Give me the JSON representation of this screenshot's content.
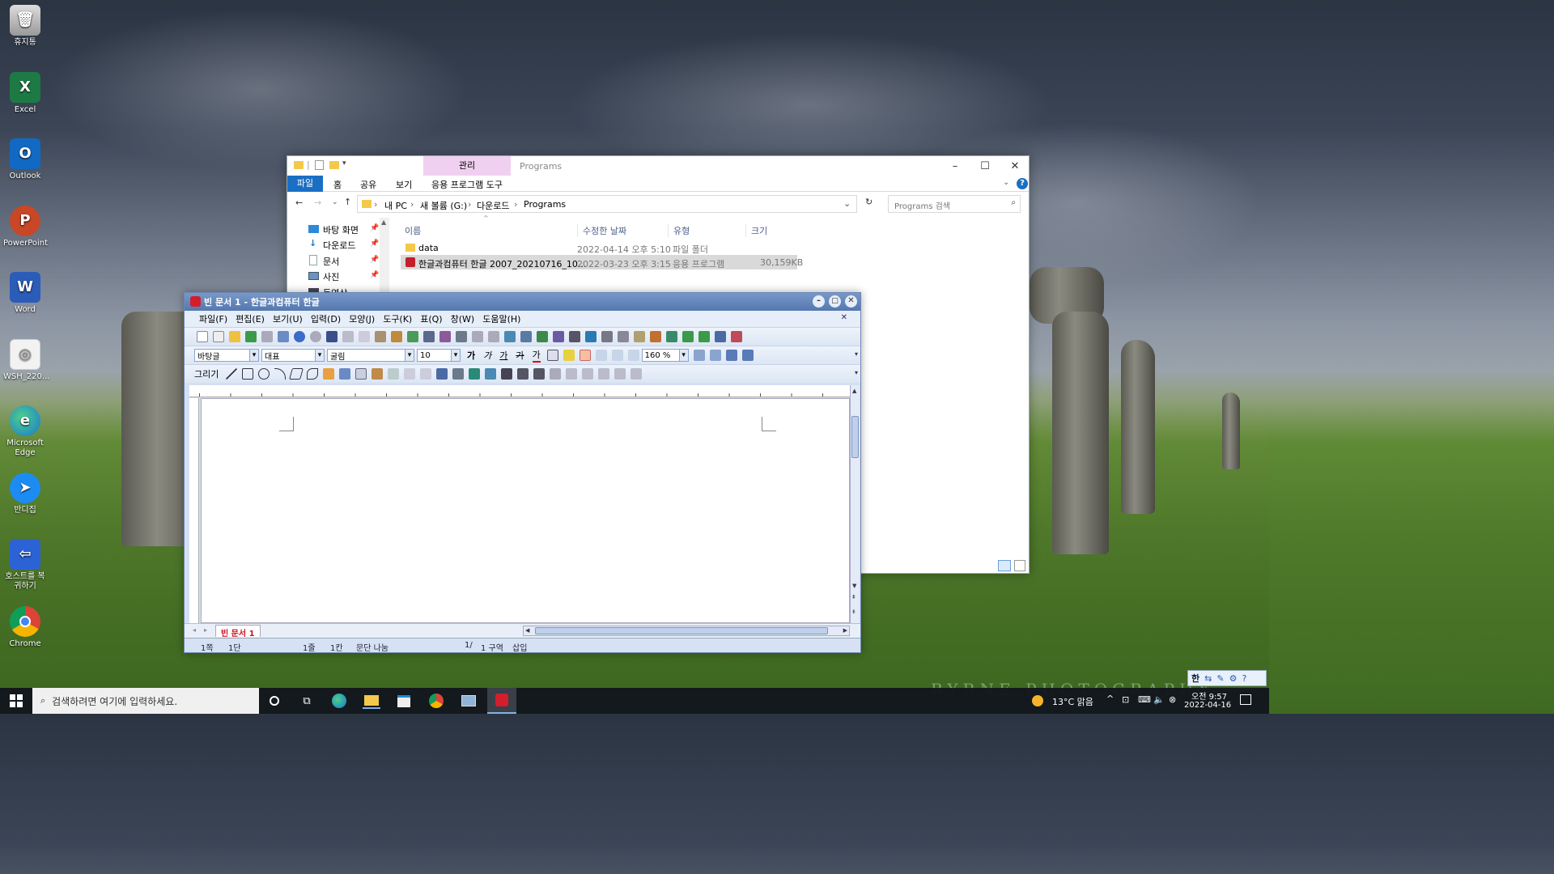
{
  "desktop": {
    "icons": [
      {
        "label": "휴지통",
        "icon": "recycle-bin-icon"
      },
      {
        "label": "Excel",
        "icon": "excel-icon"
      },
      {
        "label": "Outlook",
        "icon": "outlook-icon"
      },
      {
        "label": "PowerPoint",
        "icon": "powerpoint-icon"
      },
      {
        "label": "Word",
        "icon": "word-icon"
      },
      {
        "label": "WSH_220...",
        "icon": "disc-image-icon"
      },
      {
        "label": "Microsoft Edge",
        "icon": "edge-icon"
      },
      {
        "label": "반디집",
        "icon": "bandizip-icon"
      },
      {
        "label": "호스트를 복귀하기",
        "icon": "host-return-icon"
      },
      {
        "label": "Chrome",
        "icon": "chrome-icon"
      }
    ],
    "watermark": "BYRNE PHOTOGRAPHY"
  },
  "explorer": {
    "quick_access_sep": "|",
    "manage_tab": "관리",
    "window_title": "Programs",
    "tabs": [
      "파일",
      "홈",
      "공유",
      "보기",
      "응용 프로그램 도구"
    ],
    "breadcrumb": [
      "내 PC",
      "새 볼륨 (G:)",
      "다운로드",
      "Programs"
    ],
    "search_placeholder": "Programs 검색",
    "nav_items": [
      "바탕 화면",
      "다운로드",
      "문서",
      "사진",
      "동영상"
    ],
    "columns": [
      "이름",
      "수정한 날짜",
      "유형",
      "크기"
    ],
    "rows": [
      {
        "name": "data",
        "date": "2022-04-14 오후 5:10",
        "type": "파일 폴더",
        "size": ""
      },
      {
        "name": "한글과컴퓨터 한글 2007_20210716_10...",
        "date": "2022-03-23 오후 3:15",
        "type": "응용 프로그램",
        "size": "30,159KB"
      }
    ]
  },
  "hangul": {
    "title": "빈 문서 1 - 한글과컴퓨터 한글",
    "menu": [
      "파일(F)",
      "편집(E)",
      "보기(U)",
      "입력(D)",
      "모양(J)",
      "도구(K)",
      "표(Q)",
      "창(W)",
      "도움말(H)"
    ],
    "style": "바탕글",
    "lang": "대표",
    "font": "굴림",
    "size": "10",
    "zoom": "160 %",
    "draw": "그리기",
    "bold": "가",
    "italic": "가",
    "underline": "가",
    "strike": "가",
    "color_a": "가",
    "doc_tab": "빈 문서 1",
    "status": {
      "page": "1쪽",
      "col": "1단",
      "line": "1줄",
      "cell": "1칸",
      "break": "문단 나눔",
      "pages": "1/",
      "section": "1 구역",
      "mode": "삽입"
    }
  },
  "taskbar": {
    "search_placeholder": "검색하려면 여기에 입력하세요.",
    "weather": "13°C 맑음",
    "time": "오전 9:57",
    "date": "2022-04-16",
    "ime": "한"
  }
}
